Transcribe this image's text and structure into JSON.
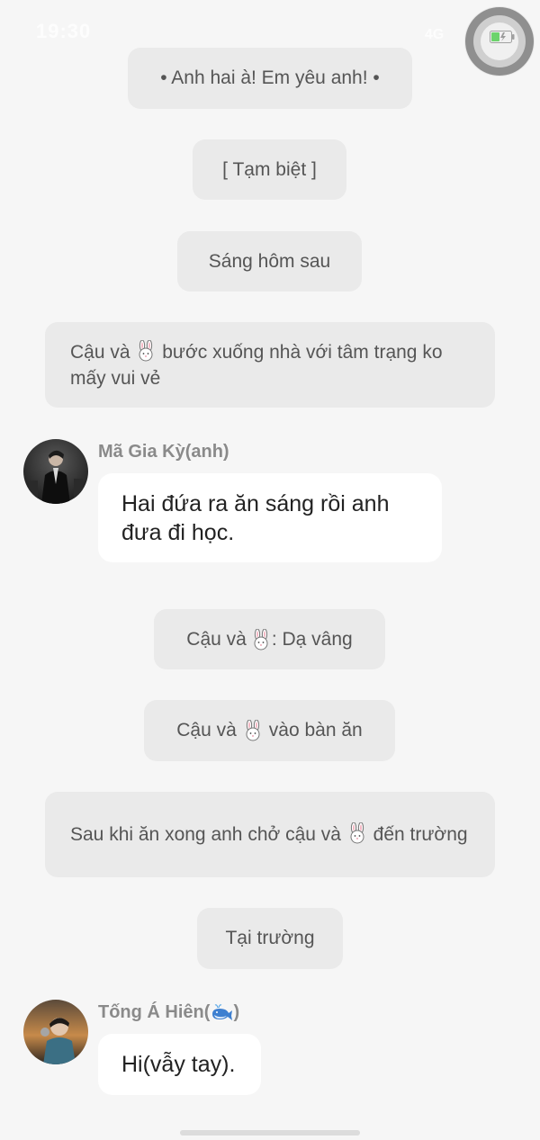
{
  "status_bar": {
    "time": "19:30",
    "network": "4G"
  },
  "narration": [
    {
      "text": "• Anh hai à! Em yêu anh! •"
    },
    {
      "text": "[ Tạm biệt ]"
    },
    {
      "text": "Sáng hôm sau"
    },
    {
      "before": "Cậu và",
      "after": "bước xuống nhà với tâm trạng ko mấy vui vẻ"
    },
    {
      "before": "Cậu và",
      "after": ": Dạ vâng"
    },
    {
      "before": "Cậu và",
      "after": "vào bàn ăn"
    },
    {
      "before": "Sau khi ăn xong anh chở cậu và",
      "after": "đến trường"
    },
    {
      "text": "Tại trường"
    }
  ],
  "messages": [
    {
      "sender": "Mã Gia Kỳ(anh)",
      "text": "Hai đứa ra ăn sáng rồi anh đưa đi học."
    },
    {
      "sender_prefix": "Tống Á Hiên(",
      "sender_suffix": ")",
      "sender_icon": "whale-icon",
      "text": "Hi(vẫy tay)."
    }
  ],
  "icons": {
    "bunny": "bunny-icon",
    "battery": "battery-icon",
    "assistive": "assistive-touch-button"
  },
  "colors": {
    "background": "#f6f6f6",
    "pill": "#eaeaea",
    "bubble": "#ffffff",
    "name": "#8a8a8a",
    "battery_green": "#6cd36c"
  }
}
